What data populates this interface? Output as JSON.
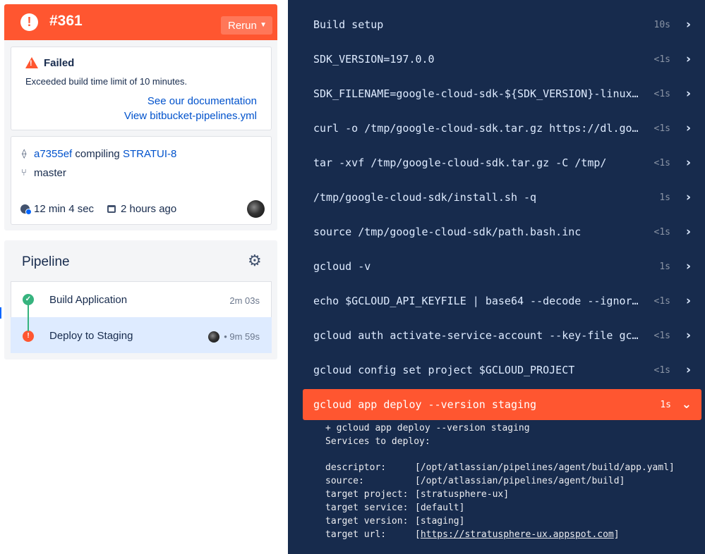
{
  "header": {
    "icon": "!",
    "build_number": "#361",
    "rerun_label": "Rerun"
  },
  "status": {
    "title": "Failed",
    "message": "Exceeded build time limit of 10 minutes.",
    "doc_link": "See our documentation",
    "yml_link": "View bitbucket-pipelines.yml"
  },
  "commit": {
    "hash": "a7355ef",
    "verb": "compiling",
    "issue": "STRATUI-8",
    "branch": "master",
    "duration": "12 min 4 sec",
    "time_ago": "2 hours ago"
  },
  "pipeline": {
    "title": "Pipeline",
    "steps": [
      {
        "name": "Build Application",
        "duration": "2m 03s",
        "status": "success"
      },
      {
        "name": "Deploy to Staging",
        "duration": "• 9m 59s",
        "status": "failed"
      }
    ]
  },
  "log": {
    "commands": [
      {
        "text": "Build setup",
        "duration": "10s"
      },
      {
        "text": "SDK_VERSION=197.0.0",
        "duration": "<1s"
      },
      {
        "text": "SDK_FILENAME=google-cloud-sdk-${SDK_VERSION}-linux…",
        "duration": "<1s"
      },
      {
        "text": "curl -o /tmp/google-cloud-sdk.tar.gz https://dl.go…",
        "duration": "<1s"
      },
      {
        "text": "tar -xvf /tmp/google-cloud-sdk.tar.gz -C /tmp/",
        "duration": "<1s"
      },
      {
        "text": "/tmp/google-cloud-sdk/install.sh -q",
        "duration": "1s"
      },
      {
        "text": "source /tmp/google-cloud-sdk/path.bash.inc",
        "duration": "<1s"
      },
      {
        "text": "gcloud -v",
        "duration": "1s"
      },
      {
        "text": "echo $GCLOUD_API_KEYFILE | base64 --decode --ignor…",
        "duration": "<1s"
      },
      {
        "text": "gcloud auth activate-service-account --key-file gc…",
        "duration": "<1s"
      },
      {
        "text": "gcloud config set project $GCLOUD_PROJECT",
        "duration": "<1s"
      }
    ],
    "active_command": {
      "text": "gcloud app deploy --version staging",
      "duration": "1s"
    },
    "output": {
      "line1": "+ gcloud app deploy --version staging",
      "line2": "Services to deploy:",
      "rows": [
        {
          "key": "descriptor:",
          "value": "[/opt/atlassian/pipelines/agent/build/app.yaml]"
        },
        {
          "key": "source:",
          "value": "[/opt/atlassian/pipelines/agent/build]"
        },
        {
          "key": "target project:",
          "value": "[stratusphere-ux]"
        },
        {
          "key": "target service:",
          "value": "[default]"
        },
        {
          "key": "target version:",
          "value": "[staging]"
        }
      ],
      "url_key": "target url:",
      "url_open": "[",
      "url": "https://stratusphere-ux.appspot.com",
      "url_close": "]"
    }
  },
  "colors": {
    "accent": "#ff5630",
    "success": "#36b37e",
    "link": "#0052cc",
    "log_bg": "#172b4d"
  },
  "icons": {
    "status": "warning-icon",
    "settings": "gear-icon",
    "expand": "chevron-right-icon"
  }
}
